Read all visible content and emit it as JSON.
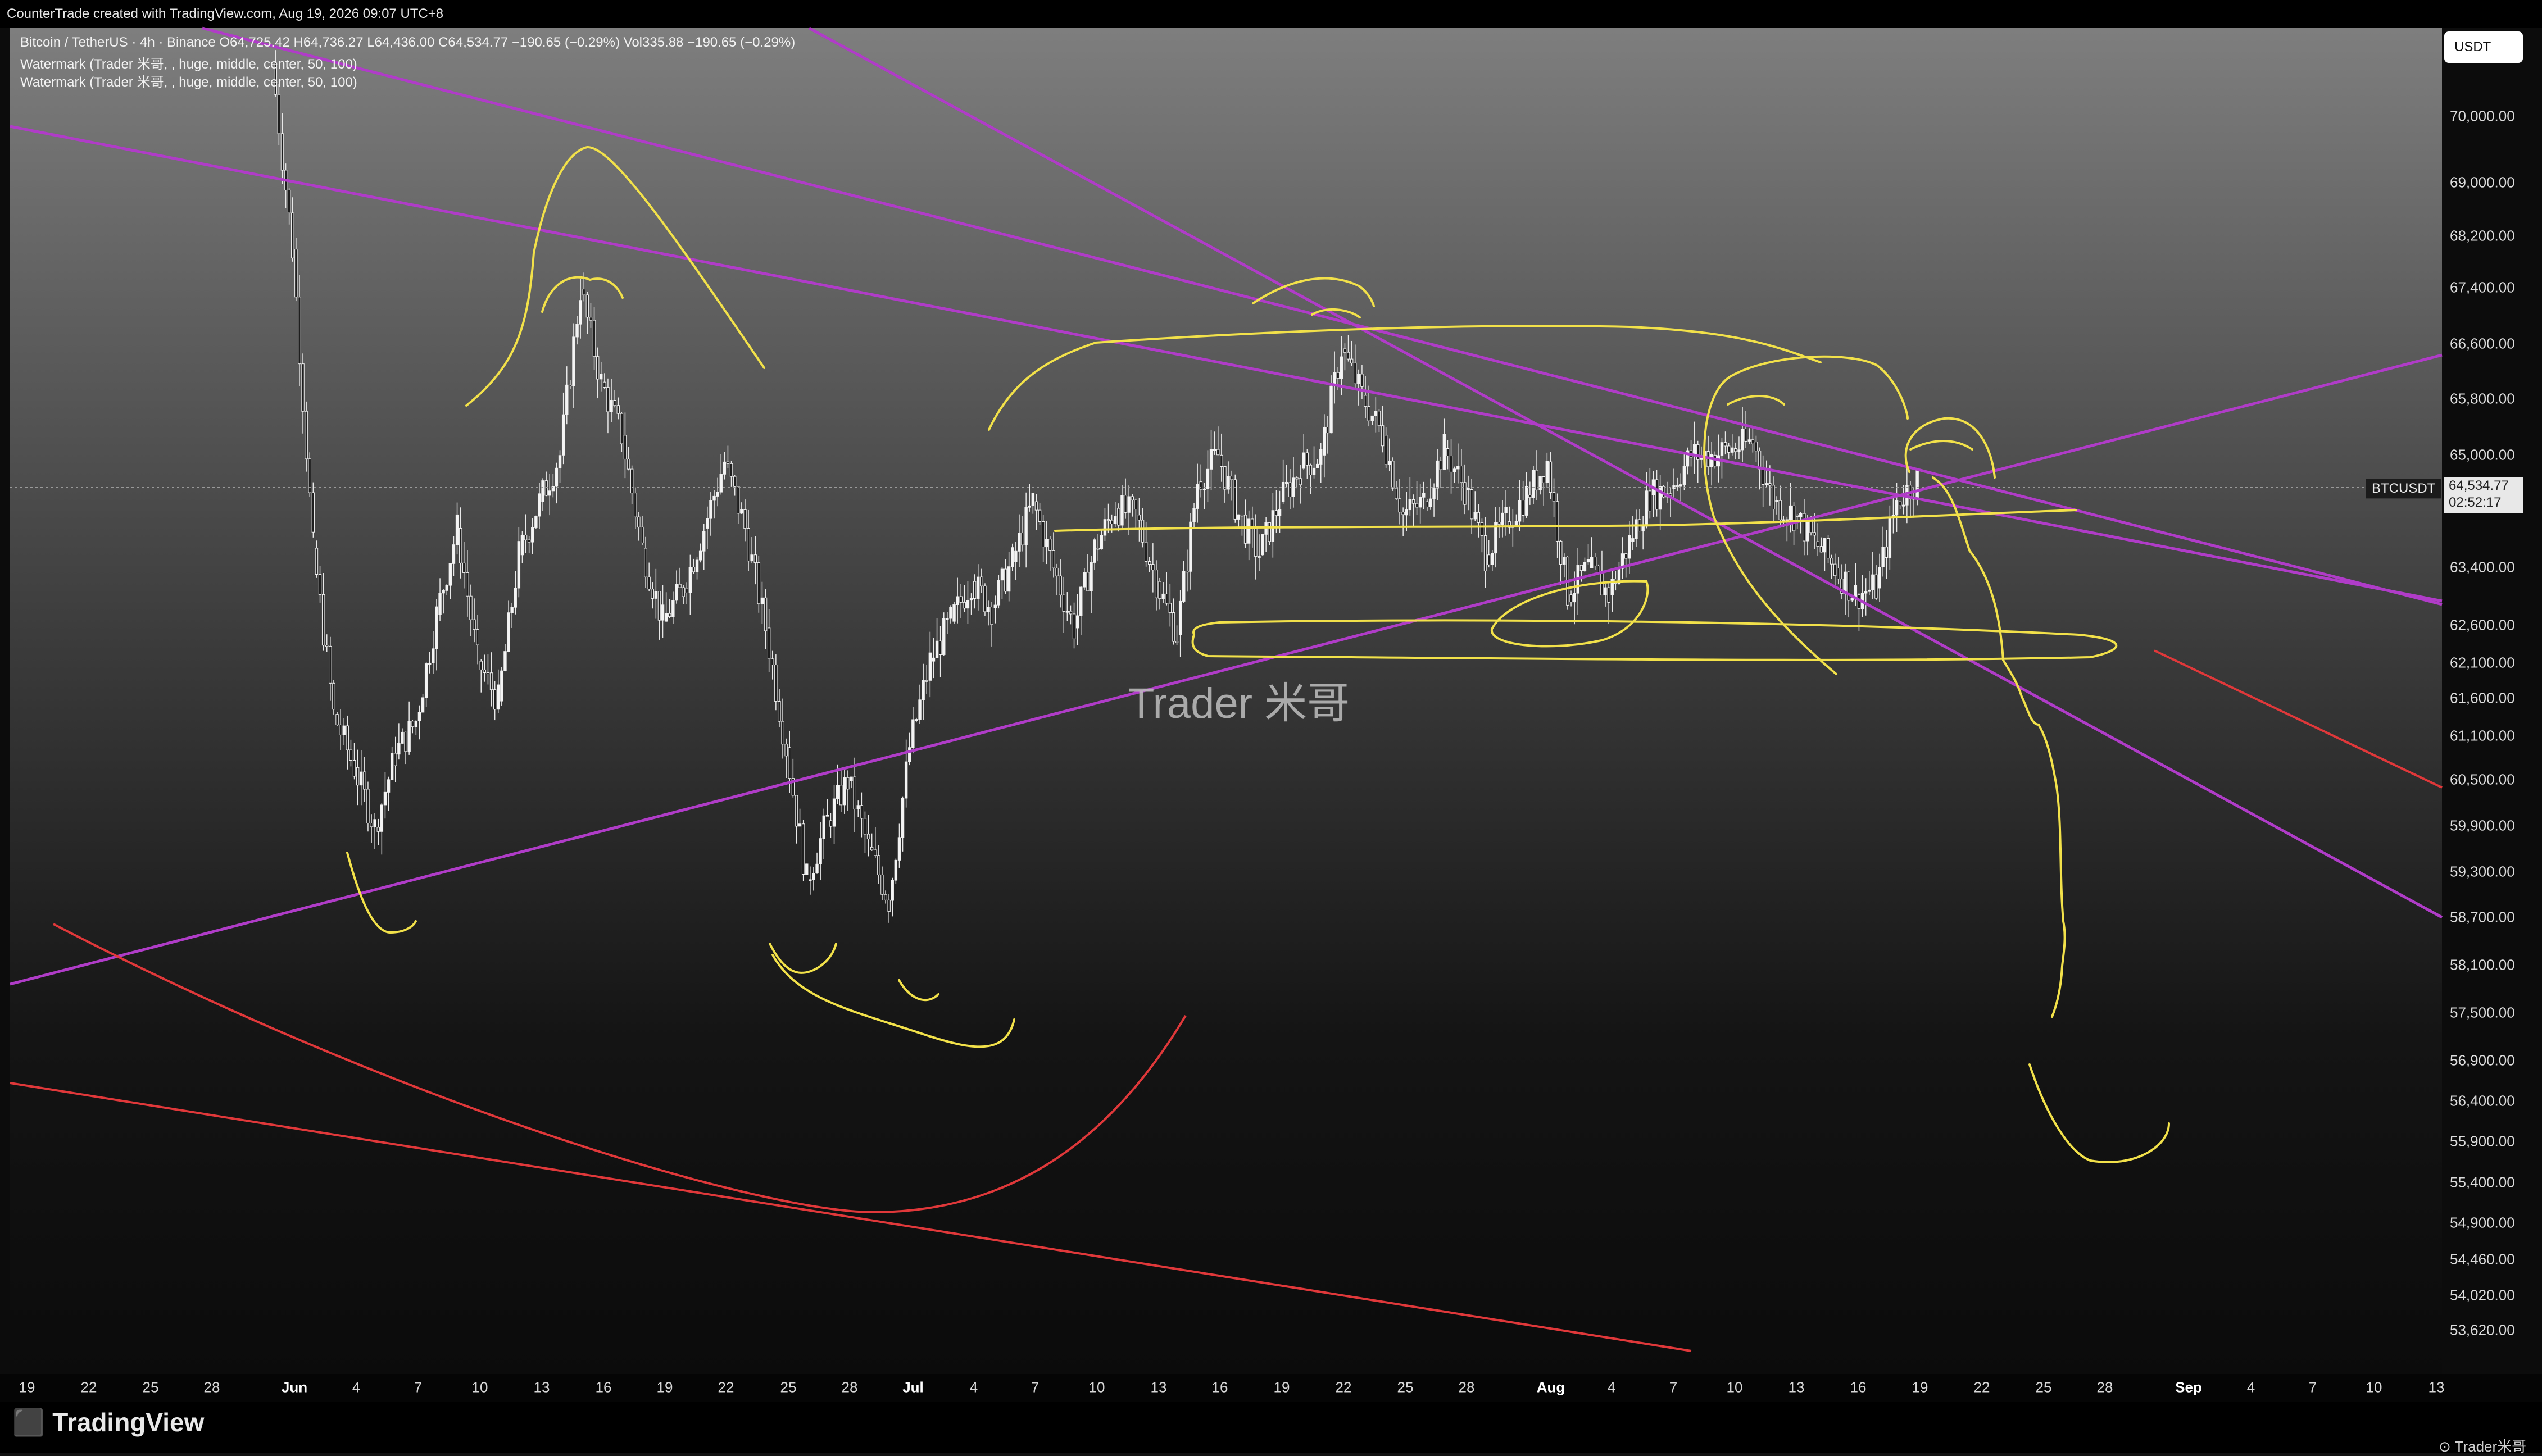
{
  "header": {
    "title": "CounterTrade created with TradingView.com, Aug 19, 2026 09:07 UTC+8"
  },
  "legend": {
    "line1": "Bitcoin / TetherUS · 4h · Binance  O64,725.42 H64,736.27 L64,436.00 C64,534.77 −190.65 (−0.29%) Vol335.88 −190.65 (−0.29%)",
    "line2": "Watermark (Trader 米哥, , huge, middle, center, 50, 100)",
    "line3": "Watermark (Trader 米哥, , huge, middle, center, 50, 100)"
  },
  "currency_button": "USDT",
  "symbol_label": "BTCUSDT",
  "last_price": "64,534.77",
  "countdown": "02:52:17",
  "watermark": "Trader 米哥",
  "price_axis": [
    "70,000.00",
    "69,000.00",
    "68,200.00",
    "67,400.00",
    "66,600.00",
    "65,800.00",
    "65,000.00",
    "63,400.00",
    "62,600.00",
    "62,100.00",
    "61,600.00",
    "61,100.00",
    "60,500.00",
    "59,900.00",
    "59,300.00",
    "58,700.00",
    "58,100.00",
    "57,500.00",
    "56,900.00",
    "56,400.00",
    "55,900.00",
    "55,400.00",
    "54,900.00",
    "54,460.00",
    "54,020.00",
    "53,620.00"
  ],
  "date_axis": [
    "19",
    "22",
    "25",
    "28",
    "Jun",
    "4",
    "7",
    "10",
    "13",
    "16",
    "19",
    "22",
    "25",
    "28",
    "Jul",
    "4",
    "7",
    "10",
    "13",
    "16",
    "19",
    "22",
    "25",
    "28",
    "Aug",
    "4",
    "7",
    "10",
    "13",
    "16",
    "19",
    "22",
    "25",
    "28",
    "Sep",
    "4",
    "7",
    "10",
    "13"
  ],
  "footer": {
    "brand": "TradingView",
    "attribution": "Trader米哥"
  },
  "colors": {
    "trendline": "#b03cc8",
    "drawing": "#f2e14a",
    "support_red": "#e0383a",
    "candle": "#f0f0f0"
  },
  "chart_data": {
    "type": "candlestick",
    "symbol": "Bitcoin / TetherUS",
    "interval": "4h",
    "exchange": "Binance",
    "ohlc_last": {
      "open": 64725.42,
      "high": 64736.27,
      "low": 64436.0,
      "close": 64534.77,
      "change": -190.65,
      "change_pct": -0.29,
      "volume": 335.88
    },
    "x_range": [
      "May 19",
      "Sep 13"
    ],
    "y_range": [
      53400,
      71000
    ],
    "price_path": [
      [
        "May 31",
        70800
      ],
      [
        "Jun 1",
        68000
      ],
      [
        "Jun 2",
        63500
      ],
      [
        "Jun 3",
        61000
      ],
      [
        "Jun 4",
        60200
      ],
      [
        "Jun 5",
        59300
      ],
      [
        "Jun 6",
        60400
      ],
      [
        "Jun 7",
        60900
      ],
      [
        "Jun 8",
        62500
      ],
      [
        "Jun 9",
        63800
      ],
      [
        "Jun 10",
        61800
      ],
      [
        "Jun 11",
        61200
      ],
      [
        "Jun 12",
        63400
      ],
      [
        "Jun 13",
        64200
      ],
      [
        "Jun 14",
        64900
      ],
      [
        "Jun 15",
        67400
      ],
      [
        "Jun 16",
        66000
      ],
      [
        "Jun 17",
        65200
      ],
      [
        "Jun 18",
        63500
      ],
      [
        "Jun 19",
        62400
      ],
      [
        "Jun 20",
        62900
      ],
      [
        "Jun 21",
        63800
      ],
      [
        "Jun 22",
        64800
      ],
      [
        "Jun 23",
        63800
      ],
      [
        "Jun 24",
        62300
      ],
      [
        "Jun 25",
        60500
      ],
      [
        "Jun 26",
        58500
      ],
      [
        "Jun 27",
        59400
      ],
      [
        "Jun 28",
        60000
      ],
      [
        "Jun 29",
        59000
      ],
      [
        "Jun 30",
        58200
      ],
      [
        "Jul 1",
        60500
      ],
      [
        "Jul 2",
        61800
      ],
      [
        "Jul 3",
        62400
      ],
      [
        "Jul 4",
        63000
      ],
      [
        "Jul 5",
        62600
      ],
      [
        "Jul 6",
        63300
      ],
      [
        "Jul 7",
        64200
      ],
      [
        "Jul 8",
        63200
      ],
      [
        "Jul 9",
        62300
      ],
      [
        "Jul 10",
        63500
      ],
      [
        "Jul 11",
        64100
      ],
      [
        "Jul 12",
        64000
      ],
      [
        "Jul 13",
        63000
      ],
      [
        "Jul 14",
        62200
      ],
      [
        "Jul 15",
        64500
      ],
      [
        "Jul 16",
        64900
      ],
      [
        "Jul 17",
        64000
      ],
      [
        "Jul 18",
        63400
      ],
      [
        "Jul 19",
        64200
      ],
      [
        "Jul 20",
        64700
      ],
      [
        "Jul 21",
        64900
      ],
      [
        "Jul 22",
        66500
      ],
      [
        "Jul 23",
        65800
      ],
      [
        "Jul 24",
        65200
      ],
      [
        "Jul 25",
        64000
      ],
      [
        "Jul 26",
        64200
      ],
      [
        "Jul 27",
        65000
      ],
      [
        "Jul 28",
        64400
      ],
      [
        "Jul 29",
        63400
      ],
      [
        "Jul 30",
        63900
      ],
      [
        "Jul 31",
        64300
      ],
      [
        "Aug 1",
        64800
      ],
      [
        "Aug 2",
        62800
      ],
      [
        "Aug 3",
        63200
      ],
      [
        "Aug 4",
        62800
      ],
      [
        "Aug 5",
        63600
      ],
      [
        "Aug 6",
        64300
      ],
      [
        "Aug 7",
        64400
      ],
      [
        "Aug 8",
        64900
      ],
      [
        "Aug 9",
        64900
      ],
      [
        "Aug 10",
        65000
      ],
      [
        "Aug 11",
        65100
      ],
      [
        "Aug 12",
        64200
      ],
      [
        "Aug 13",
        64000
      ],
      [
        "Aug 14",
        63600
      ],
      [
        "Aug 15",
        63200
      ],
      [
        "Aug 16",
        62800
      ],
      [
        "Aug 17",
        62900
      ],
      [
        "Aug 18",
        64200
      ],
      [
        "Aug 19",
        64535
      ]
    ]
  }
}
